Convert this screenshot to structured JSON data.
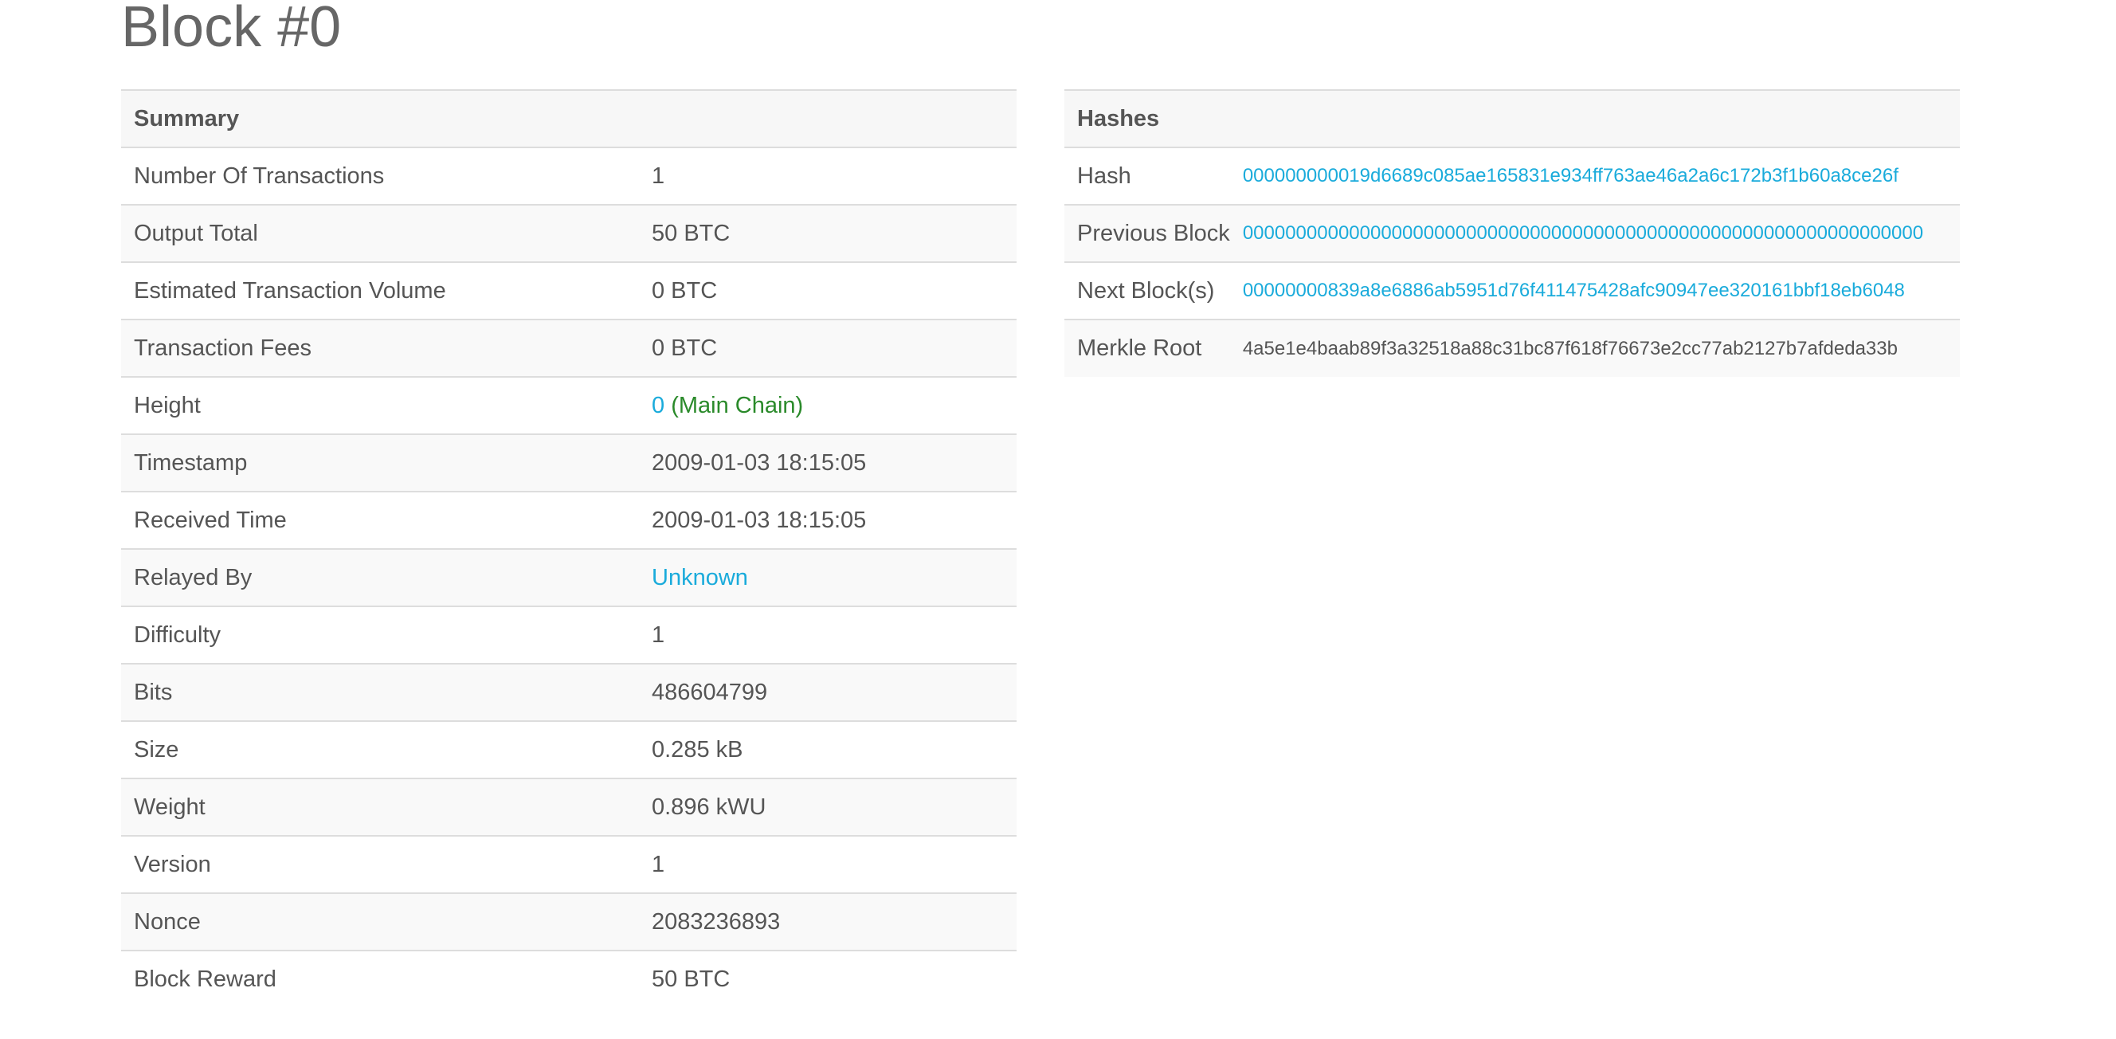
{
  "page": {
    "title": "Block #0"
  },
  "summary": {
    "header": "Summary",
    "rows": [
      {
        "label": "Number Of Transactions",
        "value": "1"
      },
      {
        "label": "Output Total",
        "value": "50 BTC"
      },
      {
        "label": "Estimated Transaction Volume",
        "value": "0 BTC"
      },
      {
        "label": "Transaction Fees",
        "value": "0 BTC"
      },
      {
        "label": "Height",
        "value": "0",
        "suffix": "(Main Chain)"
      },
      {
        "label": "Timestamp",
        "value": "2009-01-03 18:15:05"
      },
      {
        "label": "Received Time",
        "value": "2009-01-03 18:15:05"
      },
      {
        "label": "Relayed By",
        "value": "Unknown"
      },
      {
        "label": "Difficulty",
        "value": "1"
      },
      {
        "label": "Bits",
        "value": "486604799"
      },
      {
        "label": "Size",
        "value": "0.285 kB"
      },
      {
        "label": "Weight",
        "value": "0.896 kWU"
      },
      {
        "label": "Version",
        "value": "1"
      },
      {
        "label": "Nonce",
        "value": "2083236893"
      },
      {
        "label": "Block Reward",
        "value": "50 BTC"
      }
    ]
  },
  "hashes": {
    "header": "Hashes",
    "rows": [
      {
        "label": "Hash",
        "value": "000000000019d6689c085ae165831e934ff763ae46a2a6c172b3f1b60a8ce26f"
      },
      {
        "label": "Previous Block",
        "value": "0000000000000000000000000000000000000000000000000000000000000000"
      },
      {
        "label": "Next Block(s)",
        "value": "00000000839a8e6886ab5951d76f411475428afc90947ee320161bbf18eb6048"
      },
      {
        "label": "Merkle Root",
        "value": "4a5e1e4baab89f3a32518a88c31bc87f618f76673e2cc77ab2127b7afdeda33b"
      }
    ]
  },
  "colors": {
    "link": "#1aabdb",
    "main_chain": "#2a8a2a",
    "text": "#555555",
    "border": "#dddddd"
  }
}
